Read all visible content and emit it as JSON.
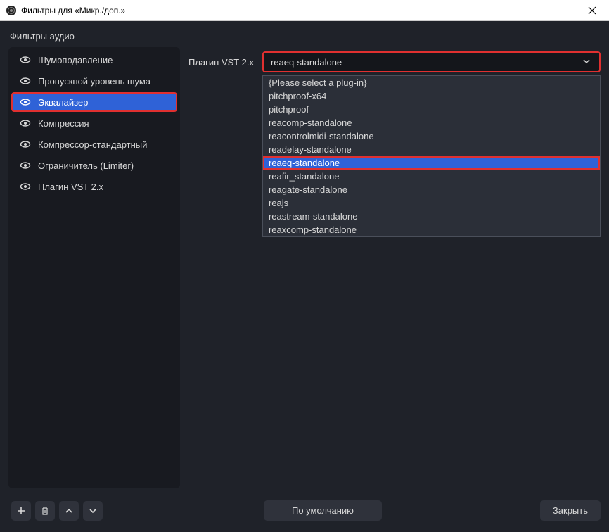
{
  "window": {
    "title": "Фильтры для «Микр./доп.»"
  },
  "section_label": "Фильтры аудио",
  "filters": [
    {
      "label": "Шумоподавление",
      "selected": false
    },
    {
      "label": "Пропускной уровень шума",
      "selected": false
    },
    {
      "label": "Эквалайзер",
      "selected": true
    },
    {
      "label": "Компрессия",
      "selected": false
    },
    {
      "label": "Компрессор-стандартный",
      "selected": false
    },
    {
      "label": "Ограничитель (Limiter)",
      "selected": false
    },
    {
      "label": "Плагин VST 2.x",
      "selected": false
    }
  ],
  "plugin_row": {
    "label": "Плагин VST 2.x",
    "value": "reaeq-standalone"
  },
  "dropdown": [
    {
      "label": "{Please select a plug-in}",
      "selected": false
    },
    {
      "label": "pitchproof-x64",
      "selected": false
    },
    {
      "label": "pitchproof",
      "selected": false
    },
    {
      "label": "reacomp-standalone",
      "selected": false
    },
    {
      "label": "reacontrolmidi-standalone",
      "selected": false
    },
    {
      "label": "readelay-standalone",
      "selected": false
    },
    {
      "label": "reaeq-standalone",
      "selected": true
    },
    {
      "label": "reafir_standalone",
      "selected": false
    },
    {
      "label": "reagate-standalone",
      "selected": false
    },
    {
      "label": "reajs",
      "selected": false
    },
    {
      "label": "reastream-standalone",
      "selected": false
    },
    {
      "label": "reaxcomp-standalone",
      "selected": false
    }
  ],
  "buttons": {
    "defaults": "По умолчанию",
    "close": "Закрыть"
  },
  "colors": {
    "accent": "#2f62d7",
    "highlight_border": "#e03030",
    "bg": "#1f2229",
    "panel": "#181a20",
    "dropdown_bg": "#2b2f38"
  }
}
